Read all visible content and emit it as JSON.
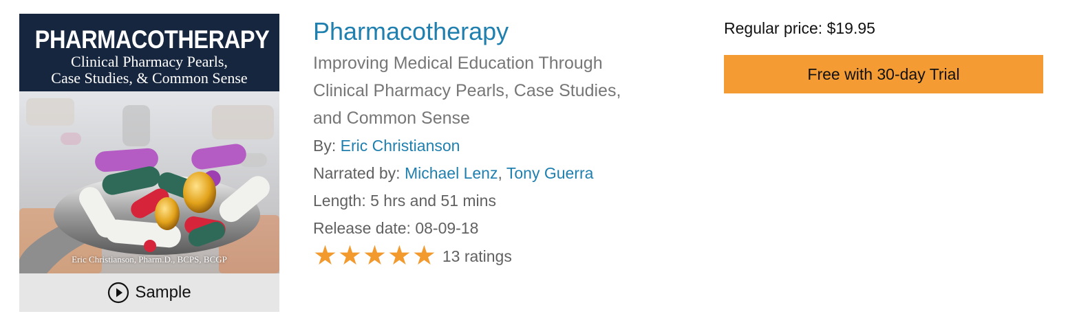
{
  "cover": {
    "title": "PHARMACOTHERAPY",
    "subtitle_line1": "Clinical Pharmacy Pearls,",
    "subtitle_line2": "Case Studies, & Common Sense",
    "author_credit": "Eric Christianson, Pharm.D., BCPS, BCGP"
  },
  "sample": {
    "icon": "play-circle-icon",
    "label": "Sample"
  },
  "book": {
    "title": "Pharmacotherapy",
    "subtitle": "Improving Medical Education Through Clinical Pharmacy Pearls, Case Studies, and Common Sense",
    "author_prefix": "By: ",
    "author": "Eric Christianson",
    "narrators_prefix": "Narrated by: ",
    "narrators": [
      "Michael Lenz",
      "Tony Guerra"
    ],
    "narrator_separator": ", ",
    "length": "Length: 5 hrs and 51 mins",
    "release_date": "Release date: 08-09-18",
    "rating": {
      "stars": 5,
      "max_stars": 5,
      "star_glyph": "★",
      "star_color": "#f29a2e",
      "count_label": "13 ratings"
    }
  },
  "purchase": {
    "regular_price": "Regular price: $19.95",
    "trial_button": "Free with 30-day Trial",
    "button_color": "#f49c33"
  },
  "colors": {
    "link": "#1f7fae",
    "muted_text": "#767676",
    "cover_header": "#17263f"
  }
}
